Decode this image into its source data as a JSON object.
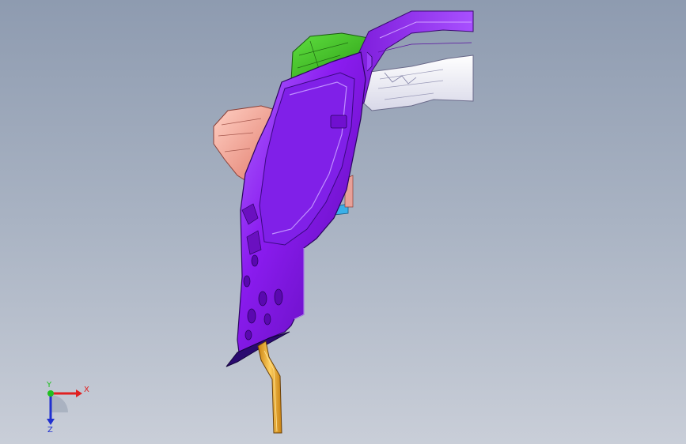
{
  "viewport": {
    "background_top": "#8e9bb0",
    "background_bottom": "#c9ced8"
  },
  "model": {
    "parts": [
      {
        "name": "main-plate",
        "color": "#8b1cf0"
      },
      {
        "name": "top-arm",
        "color": "#9b30f5"
      },
      {
        "name": "green-block",
        "color": "#3ccf1e"
      },
      {
        "name": "pink-block",
        "color": "#f2a090"
      },
      {
        "name": "white-insert",
        "color": "#f3f3f8"
      },
      {
        "name": "blue-tab",
        "color": "#3ab0e8"
      },
      {
        "name": "yellow-pin",
        "color": "#f0b030"
      },
      {
        "name": "dark-wedge",
        "color": "#3a1090"
      }
    ]
  },
  "triad": {
    "x_label": "X",
    "y_label": "Y",
    "z_label": "Z",
    "x_color": "#e02020",
    "y_color": "#20c020",
    "z_color": "#2030d0"
  }
}
